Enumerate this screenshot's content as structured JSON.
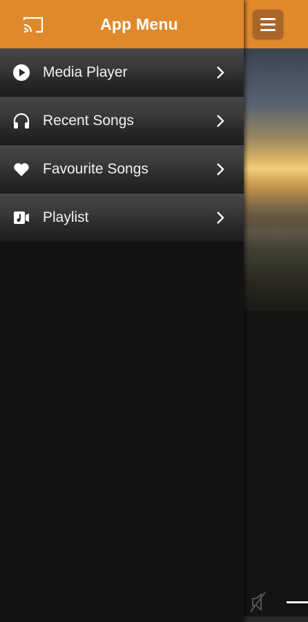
{
  "drawer": {
    "title": "App Menu",
    "cast_icon": "cast-icon",
    "items": [
      {
        "label": "Media Player",
        "icon": "play-circle-icon"
      },
      {
        "label": "Recent Songs",
        "icon": "headphones-icon"
      },
      {
        "label": "Favourite Songs",
        "icon": "heart-icon"
      },
      {
        "label": "Playlist",
        "icon": "music-file-icon"
      }
    ]
  },
  "background_app": {
    "menu_icon": "hamburger-menu-icon",
    "mute_icon": "volume-muted-icon"
  },
  "colors": {
    "header": "#e0892c",
    "menu_button": "#a9652a",
    "drawer_bg": "#131313",
    "item_text": "#f2f2f2"
  }
}
